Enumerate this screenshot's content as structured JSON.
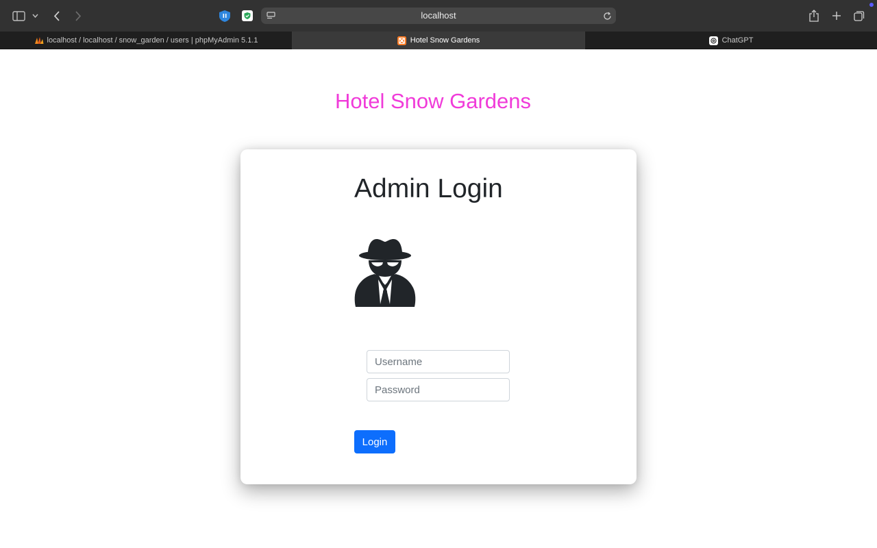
{
  "browser": {
    "url": "localhost",
    "tabs": [
      {
        "label": "localhost / localhost / snow_garden / users | phpMyAdmin 5.1.1",
        "favicon": "phpmyadmin-icon"
      },
      {
        "label": "Hotel Snow Gardens",
        "favicon": "xampp-icon"
      },
      {
        "label": "ChatGPT",
        "favicon": "chatgpt-icon"
      }
    ]
  },
  "page": {
    "site_title": "Hotel Snow Gardens",
    "card_title": "Admin Login",
    "icon": "user-secret-icon",
    "username_placeholder": "Username",
    "password_placeholder": "Password",
    "login_label": "Login"
  },
  "colors": {
    "site_title": "#f03bd9",
    "primary_button": "#0d6efd"
  }
}
